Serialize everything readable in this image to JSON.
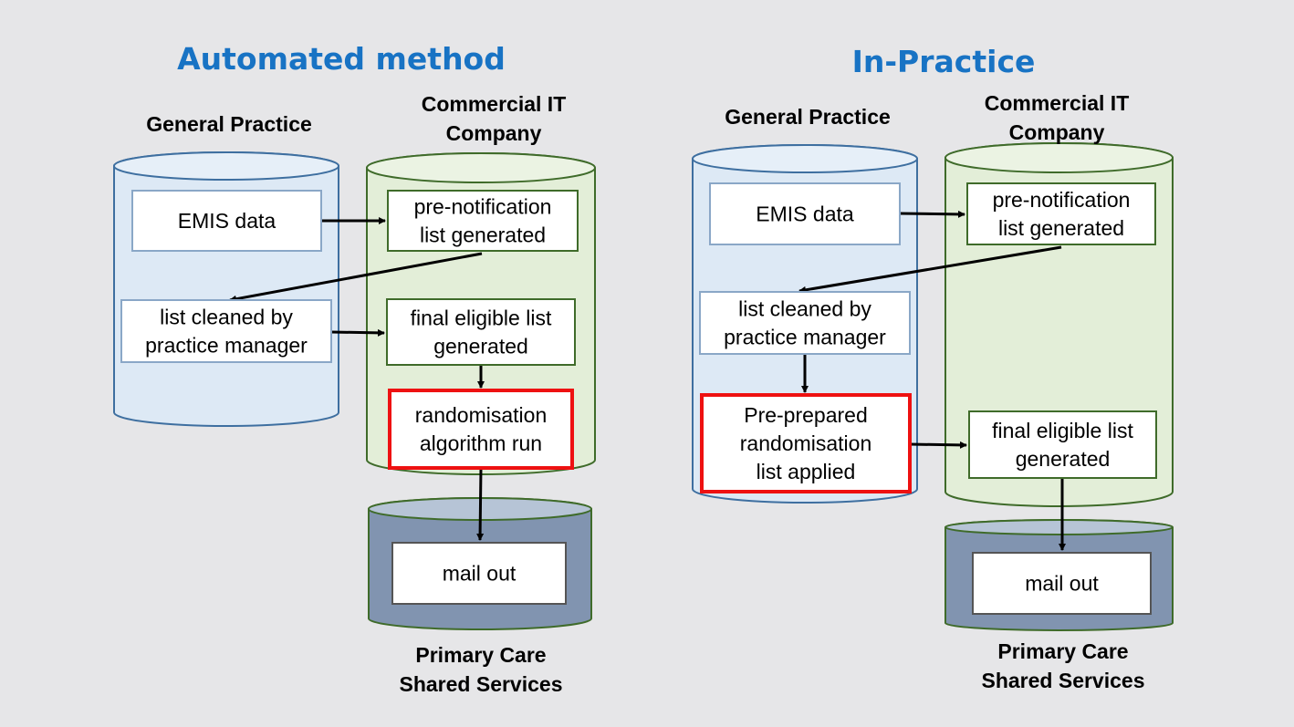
{
  "colors": {
    "background": "#e6e6e8",
    "title": "#1873c4",
    "gp_fill": "#dde9f5",
    "gp_stroke": "#3e6fa0",
    "it_fill": "#e3eed8",
    "it_stroke": "#3f6b2a",
    "pcss_fill": "#8194b0",
    "pcss_top": "#b6c4d6",
    "highlight": "#ee1111"
  },
  "panels": [
    {
      "title": "Automated method",
      "gp_label": "General Practice",
      "it_label": [
        "Commercial IT",
        "Company"
      ],
      "pcss_label": [
        "Primary Care",
        "Shared Services"
      ],
      "boxes": {
        "emis": [
          "EMIS data"
        ],
        "prenotif": [
          "pre-notification",
          "list generated"
        ],
        "cleaned": [
          "list cleaned by",
          "practice manager"
        ],
        "final": [
          "final eligible list",
          "generated"
        ],
        "random": [
          "randomisation",
          "algorithm run"
        ],
        "mail": [
          "mail out"
        ]
      }
    },
    {
      "title": "In-Practice",
      "gp_label": "General Practice",
      "it_label": [
        "Commercial IT",
        "Company"
      ],
      "pcss_label": [
        "Primary Care",
        "Shared Services"
      ],
      "boxes": {
        "emis": [
          "EMIS data"
        ],
        "prenotif": [
          "pre-notification",
          "list generated"
        ],
        "cleaned": [
          "list cleaned by",
          "practice manager"
        ],
        "random": [
          "Pre-prepared",
          "randomisation",
          "list applied"
        ],
        "final": [
          "final eligible list",
          "generated"
        ],
        "mail": [
          "mail out"
        ]
      }
    }
  ]
}
